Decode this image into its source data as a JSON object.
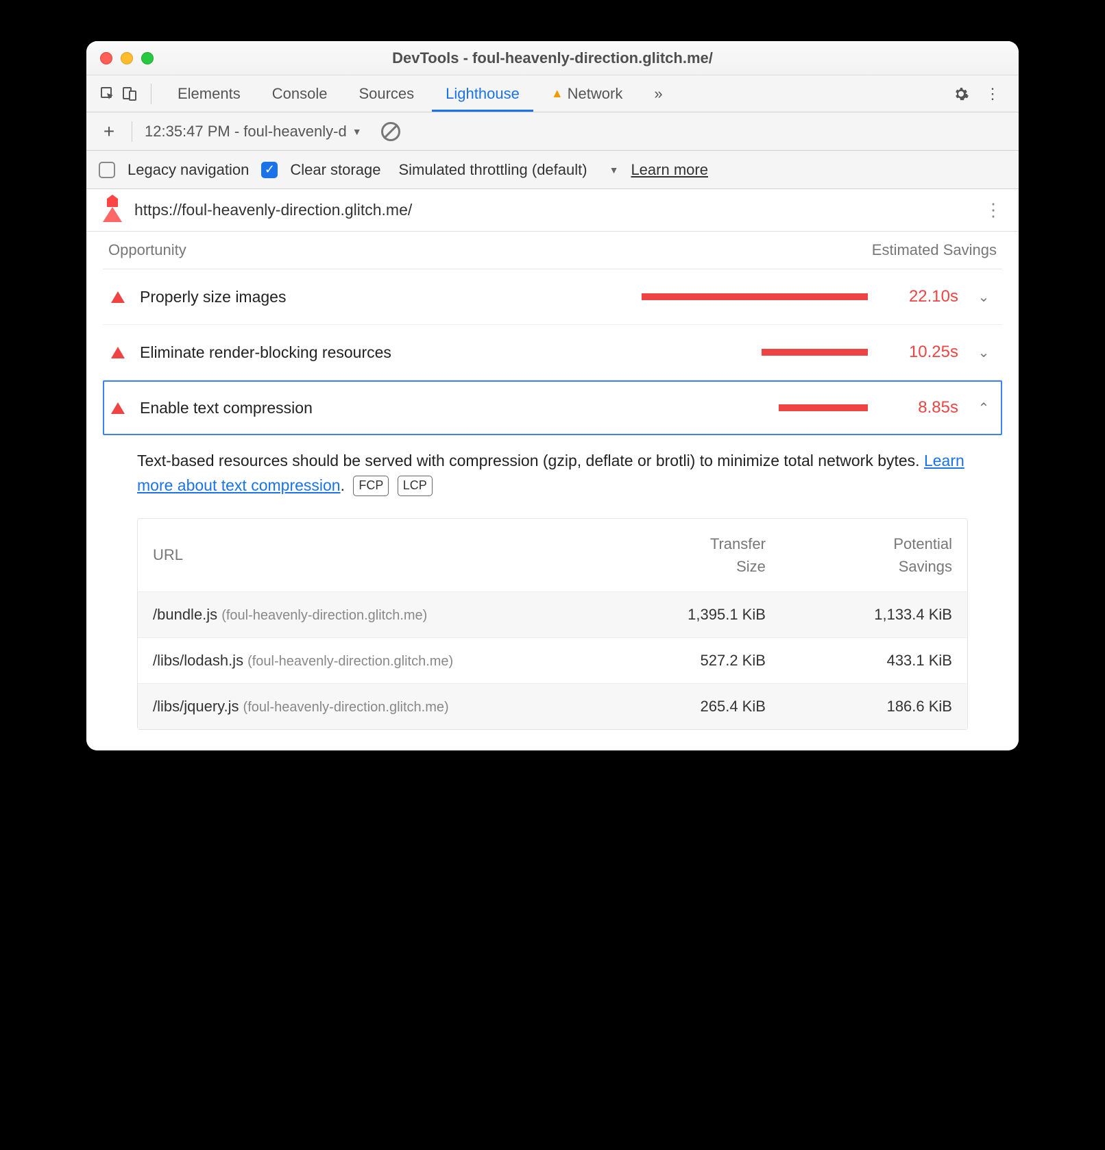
{
  "window": {
    "title": "DevTools - foul-heavenly-direction.glitch.me/"
  },
  "tabs": {
    "items": [
      "Elements",
      "Console",
      "Sources",
      "Lighthouse",
      "Network"
    ],
    "active": "Lighthouse",
    "overflow": "»"
  },
  "subbar": {
    "timestamp": "12:35:47 PM - foul-heavenly-d"
  },
  "options": {
    "legacy_label": "Legacy navigation",
    "clear_label": "Clear storage",
    "throttling": "Simulated throttling (default)",
    "learn": "Learn more"
  },
  "url": "https://foul-heavenly-direction.glitch.me/",
  "headers": {
    "opportunity": "Opportunity",
    "savings": "Estimated Savings"
  },
  "rows": [
    {
      "label": "Properly size images",
      "savings": "22.10s",
      "bar": 330,
      "expanded": false
    },
    {
      "label": "Eliminate render-blocking resources",
      "savings": "10.25s",
      "bar": 155,
      "expanded": false
    },
    {
      "label": "Enable text compression",
      "savings": "8.85s",
      "bar": 130,
      "expanded": true
    }
  ],
  "detail": {
    "text_a": "Text-based resources should be served with compression (gzip, deflate or brotli) to minimize total network bytes. ",
    "link": "Learn more about text compression",
    "period": ".",
    "chip1": "FCP",
    "chip2": "LCP"
  },
  "table": {
    "headers": {
      "url": "URL",
      "ts1": "Transfer",
      "ts2": "Size",
      "ps1": "Potential",
      "ps2": "Savings"
    },
    "rows": [
      {
        "path": "/bundle.js",
        "host": "(foul-heavenly-direction.glitch.me)",
        "ts": "1,395.1 KiB",
        "ps": "1,133.4 KiB",
        "alt": true
      },
      {
        "path": "/libs/lodash.js",
        "host": "(foul-heavenly-direction.glitch.me)",
        "ts": "527.2 KiB",
        "ps": "433.1 KiB",
        "alt": false
      },
      {
        "path": "/libs/jquery.js",
        "host": "(foul-heavenly-direction.glitch.me)",
        "ts": "265.4 KiB",
        "ps": "186.6 KiB",
        "alt": true
      }
    ]
  }
}
